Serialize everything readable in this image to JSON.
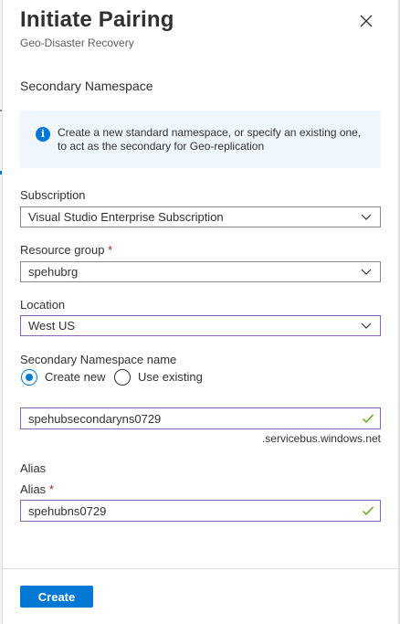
{
  "header": {
    "title": "Initiate Pairing",
    "subtitle": "Geo-Disaster Recovery",
    "close_icon": "close-icon"
  },
  "section": {
    "title": "Secondary Namespace"
  },
  "info": {
    "icon": "info-icon",
    "icon_glyph": "i",
    "text": "Create a new standard namespace, or specify an existing one, to act as the secondary for Geo-replication"
  },
  "subscription": {
    "label": "Subscription",
    "value": "Visual Studio Enterprise Subscription"
  },
  "resource_group": {
    "label": "Resource group",
    "required_mark": "*",
    "value": "spehubrg"
  },
  "location": {
    "label": "Location",
    "value": "West US"
  },
  "secondary_namespace": {
    "label": "Secondary Namespace name",
    "options": [
      {
        "label": "Create new",
        "selected": true
      },
      {
        "label": "Use existing",
        "selected": false
      }
    ],
    "value": "spehubsecondaryns0729",
    "suffix": ".servicebus.windows.net"
  },
  "alias_section": {
    "title": "Alias",
    "label": "Alias",
    "required_mark": "*",
    "value": "spehubns0729"
  },
  "footer": {
    "create_label": "Create"
  },
  "colors": {
    "accent": "#0078d4",
    "focus_border": "#8764b8",
    "valid_check": "#57a300",
    "required": "#a4262c",
    "info_background": "#eff6fc"
  }
}
